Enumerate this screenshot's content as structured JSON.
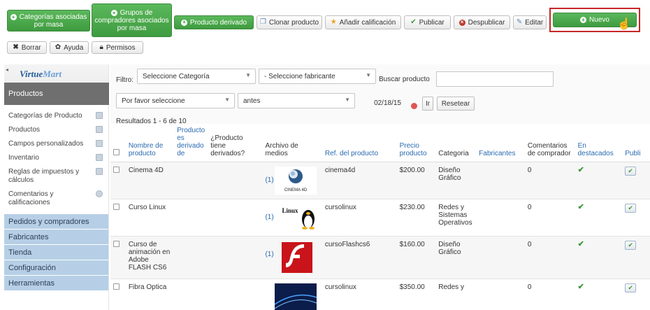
{
  "toolbar": {
    "buttons": {
      "categorias_masa": "Categorías asociadas por masa",
      "grupos_masa": "Grupos de compradores asociados por masa",
      "producto_derivado": "Producto derivado",
      "clonar": "Clonar producto",
      "calificacion": "Añadir calificación",
      "publicar": "Publicar",
      "despublicar": "Despublicar",
      "editar": "Editar",
      "nuevo": "Nuevo",
      "borrar": "Borrar",
      "ayuda": "Ayuda",
      "permisos": "Permisos"
    }
  },
  "sidebar": {
    "logo": {
      "part1": "Virtue",
      "part2": "Mart"
    },
    "section": "Productos",
    "items": [
      {
        "label": "Categorías de Producto"
      },
      {
        "label": "Productos"
      },
      {
        "label": "Campos personalizados"
      },
      {
        "label": "Inventario"
      },
      {
        "label": "Reglas de impuestos y cálculos"
      },
      {
        "label": "Comentarios y calificaciones"
      }
    ],
    "groups": [
      "Pedidos y compradores",
      "Fabricantes",
      "Tienda",
      "Configuración",
      "Herramientas"
    ]
  },
  "filters": {
    "filter_label": "Filtro:",
    "category_select": "Seleccione Categoría",
    "manufacturer_select": "- Seleccione fabricante",
    "search_label": "Buscar producto",
    "search_value": "",
    "pick_select": "Por favor seleccione",
    "when_select": "antes",
    "date_value": "02/18/15",
    "go_button": "Ir",
    "reset_button": "Resetear",
    "results": "Resultados 1 - 6 de 10"
  },
  "table": {
    "headers": {
      "name": "Nombre de producto",
      "is_derived": "Producto es derivado de",
      "has_derived": "¿Producto tiene derivados?",
      "media": "Archivo de medios",
      "sku": "Ref. del producto",
      "price": "Precio producto",
      "category": "Categoria",
      "manufacturers": "Fabricantes",
      "reviews": "Comentarios de comprador",
      "featured": "En destacados",
      "published": "Publi"
    },
    "rows": [
      {
        "name": "Cinema 4D",
        "media_count": "(1)",
        "thumb_label": "CINEMA 4D",
        "sku": "cinema4d",
        "price": "$200.00",
        "category": "Diseño Gráfico",
        "reviews": "0",
        "featured": "✔",
        "published": "✔"
      },
      {
        "name": "Curso Linux",
        "media_count": "(1)",
        "thumb_label": "Linux",
        "sku": "cursolinux",
        "price": "$230.00",
        "category": "Redes y Sistemas Operativos",
        "reviews": "0",
        "featured": "✔",
        "published": "✔"
      },
      {
        "name": "Curso de animación en Adobe FLASH CS6",
        "media_count": "(1)",
        "thumb_label": "",
        "sku": "cursoFlashcs6",
        "price": "$160.00",
        "category": "Diseño Gráfico",
        "reviews": "0",
        "featured": "✔",
        "published": "✔"
      },
      {
        "name": "Fibra Optica",
        "media_count": "",
        "thumb_label": "",
        "sku": "cursolinux",
        "price": "$350.00",
        "category": "Redes y",
        "reviews": "0",
        "featured": "✔",
        "published": "✔"
      }
    ]
  },
  "colors": {
    "accent_green": "#3f9b3f",
    "highlight_red": "#c62828",
    "link_blue": "#2a6bb0",
    "sidebar_group": "#b6cfe6"
  },
  "icons": [
    "plus-circle-icon",
    "copy-icon",
    "star-icon",
    "check-icon",
    "ban-icon",
    "edit-icon",
    "close-icon",
    "gear-icon",
    "lock-icon",
    "hand-cursor-icon"
  ]
}
